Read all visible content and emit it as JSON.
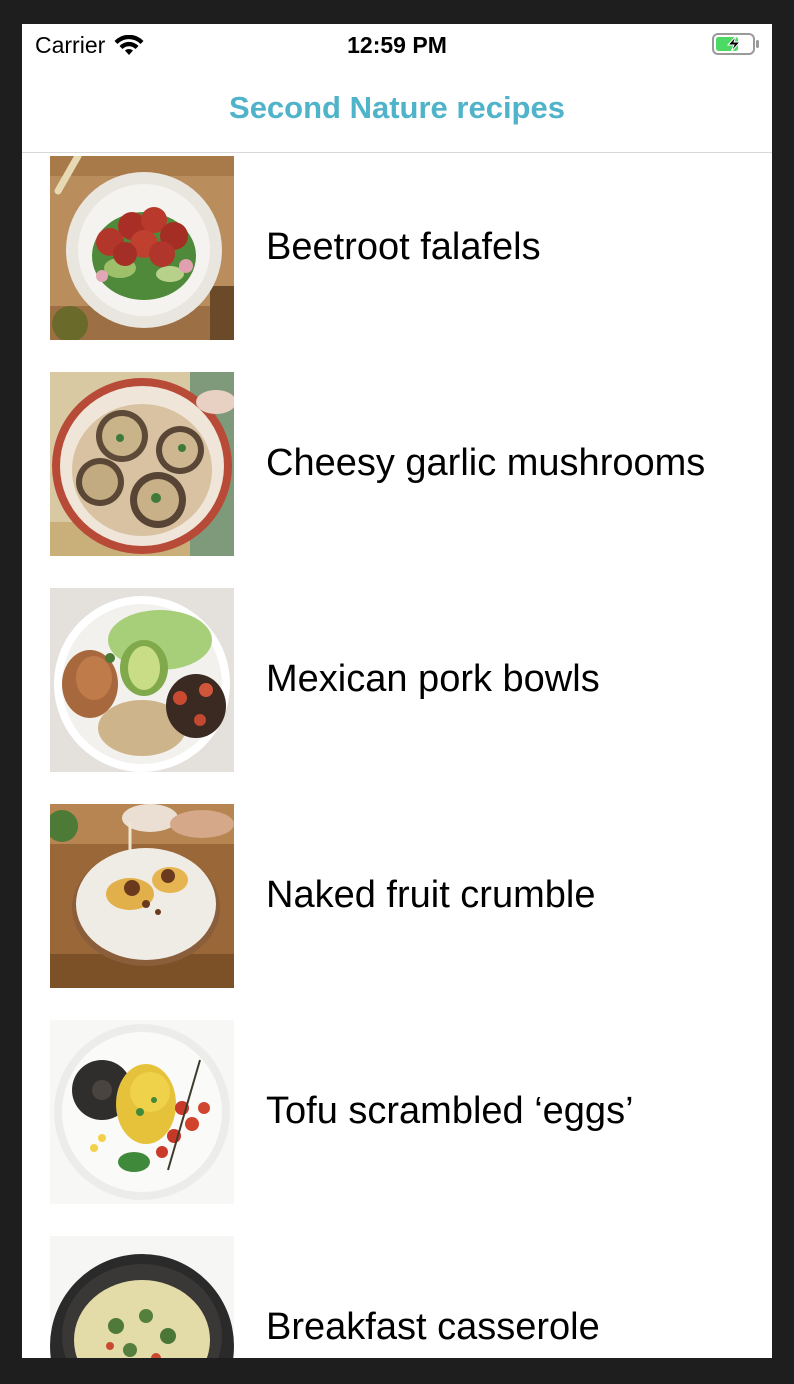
{
  "status_bar": {
    "carrier": "Carrier",
    "time": "12:59 PM",
    "wifi_icon": "wifi-icon",
    "battery_icon": "battery-charging-icon"
  },
  "nav": {
    "title": "Second Nature recipes",
    "title_color": "#4fb3c9"
  },
  "recipes": [
    {
      "title": "Beetroot falafels",
      "image": "beetroot-falafels-photo"
    },
    {
      "title": "Cheesy garlic mushrooms",
      "image": "cheesy-garlic-mushrooms-photo"
    },
    {
      "title": "Mexican pork bowls",
      "image": "mexican-pork-bowls-photo"
    },
    {
      "title": "Naked fruit crumble",
      "image": "naked-fruit-crumble-photo"
    },
    {
      "title": "Tofu scrambled ‘eggs’",
      "image": "tofu-scrambled-eggs-photo"
    },
    {
      "title": "Breakfast casserole",
      "image": "breakfast-casserole-photo"
    }
  ]
}
